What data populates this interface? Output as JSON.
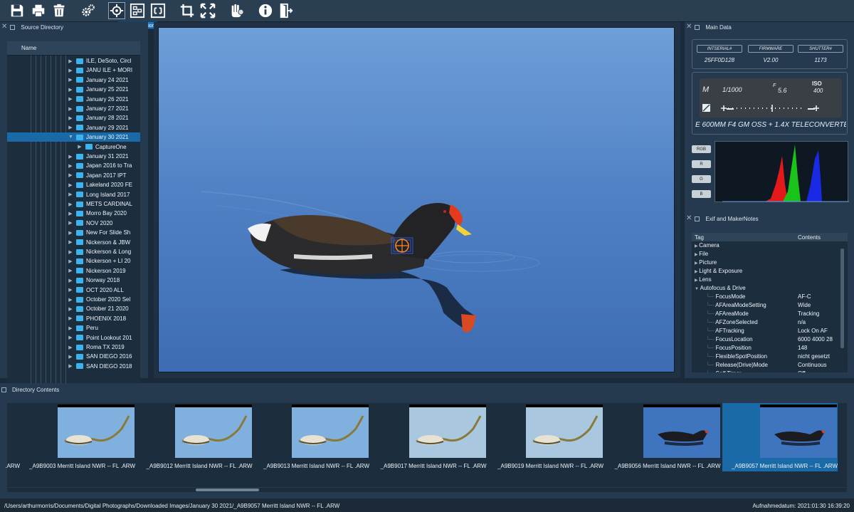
{
  "toolbar": {
    "tooltip": "Focus Location",
    "icons": [
      "save-icon",
      "print-icon",
      "delete-icon",
      "settings-icon",
      "focus-location-icon",
      "af-points-icon",
      "frame-icon",
      "crop-icon",
      "fullscreen-icon",
      "hand-icon",
      "info-icon",
      "exit-icon"
    ]
  },
  "source_directory": {
    "title": "Source Directory",
    "column": "Name",
    "items": [
      {
        "label": "ILE, DeSoto, Circl",
        "level": 0,
        "expanded": false,
        "selected": false
      },
      {
        "label": "JANU ILE + MORI",
        "level": 0,
        "expanded": false,
        "selected": false
      },
      {
        "label": "January 24 2021",
        "level": 0,
        "expanded": false,
        "selected": false
      },
      {
        "label": "January 25 2021",
        "level": 0,
        "expanded": false,
        "selected": false
      },
      {
        "label": "January 26 2021",
        "level": 0,
        "expanded": false,
        "selected": false
      },
      {
        "label": "January 27 2021",
        "level": 0,
        "expanded": false,
        "selected": false
      },
      {
        "label": "January 28 2021",
        "level": 0,
        "expanded": false,
        "selected": false
      },
      {
        "label": "January 29 2021",
        "level": 0,
        "expanded": false,
        "selected": false
      },
      {
        "label": "January 30 2021",
        "level": 0,
        "expanded": true,
        "selected": true
      },
      {
        "label": "CaptureOne",
        "level": 1,
        "expanded": false,
        "selected": false
      },
      {
        "label": "January 31 2021",
        "level": 0,
        "expanded": false,
        "selected": false
      },
      {
        "label": "Japan 2016 to Tra",
        "level": 0,
        "expanded": false,
        "selected": false
      },
      {
        "label": "Japan 2017 IPT",
        "level": 0,
        "expanded": false,
        "selected": false
      },
      {
        "label": "Lakeland 2020 FE",
        "level": 0,
        "expanded": false,
        "selected": false
      },
      {
        "label": "Long Island 2017",
        "level": 0,
        "expanded": false,
        "selected": false
      },
      {
        "label": "METS CARDINAL",
        "level": 0,
        "expanded": false,
        "selected": false
      },
      {
        "label": "Morro Bay 2020",
        "level": 0,
        "expanded": false,
        "selected": false
      },
      {
        "label": "NOV 2020",
        "level": 0,
        "expanded": false,
        "selected": false
      },
      {
        "label": "New For Slide Sh",
        "level": 0,
        "expanded": false,
        "selected": false
      },
      {
        "label": "Nickerson & JBW",
        "level": 0,
        "expanded": false,
        "selected": false
      },
      {
        "label": "Nickerson & Long",
        "level": 0,
        "expanded": false,
        "selected": false
      },
      {
        "label": "Nickerson + LI 20",
        "level": 0,
        "expanded": false,
        "selected": false
      },
      {
        "label": "Nickerson 2019",
        "level": 0,
        "expanded": false,
        "selected": false
      },
      {
        "label": "Norway 2018",
        "level": 0,
        "expanded": false,
        "selected": false
      },
      {
        "label": "OCT 2020 ALL",
        "level": 0,
        "expanded": false,
        "selected": false
      },
      {
        "label": "October 2020 Sel",
        "level": 0,
        "expanded": false,
        "selected": false
      },
      {
        "label": "October 21 2020",
        "level": 0,
        "expanded": false,
        "selected": false
      },
      {
        "label": "PHOENIX 2018",
        "level": 0,
        "expanded": false,
        "selected": false
      },
      {
        "label": "Peru",
        "level": 0,
        "expanded": false,
        "selected": false
      },
      {
        "label": "Point Lookout 201",
        "level": 0,
        "expanded": false,
        "selected": false
      },
      {
        "label": "Roma TX 2019",
        "level": 0,
        "expanded": false,
        "selected": false
      },
      {
        "label": "SAN DIEGO 2016",
        "level": 0,
        "expanded": false,
        "selected": false
      },
      {
        "label": "SAN DIEGO 2018",
        "level": 0,
        "expanded": false,
        "selected": false
      }
    ]
  },
  "main_data": {
    "title": "Main Data",
    "intserial_label": "INTSERIAL#",
    "intserial_value": "25FF0D128",
    "firmware_label": "FIRMWARE",
    "firmware_value": "V2.00",
    "shutter_label": "SHUTTER#",
    "shutter_value": "1173",
    "mode": "M",
    "shutter_speed": "1/1000",
    "f_label": "F",
    "aperture": "5.6",
    "iso_label": "ISO",
    "iso_value": "400",
    "lens": "E 600MM F4 GM OSS + 1.4X TELECONVERTE",
    "hist_buttons": [
      "RGB",
      "R",
      "G",
      "B"
    ]
  },
  "exif": {
    "title": "Exif and MakerNotes",
    "col_tag": "Tag",
    "col_contents": "Contents",
    "rows": [
      {
        "tag": "Camera",
        "value": "",
        "level": 0,
        "expanded": false
      },
      {
        "tag": "File",
        "value": "",
        "level": 0,
        "expanded": false
      },
      {
        "tag": "Picture",
        "value": "",
        "level": 0,
        "expanded": false
      },
      {
        "tag": "Light & Exposure",
        "value": "",
        "level": 0,
        "expanded": false
      },
      {
        "tag": "Lens",
        "value": "",
        "level": 0,
        "expanded": false
      },
      {
        "tag": "Autofocus & Drive",
        "value": "",
        "level": 0,
        "expanded": true
      },
      {
        "tag": "FocusMode",
        "value": "AF-C",
        "level": 1
      },
      {
        "tag": "AFAreaModeSetting",
        "value": "Wide",
        "level": 1
      },
      {
        "tag": "AFAreaMode",
        "value": "Tracking",
        "level": 1
      },
      {
        "tag": "AFZoneSelected",
        "value": "n/a",
        "level": 1
      },
      {
        "tag": "AFTracking",
        "value": "Lock On AF",
        "level": 1
      },
      {
        "tag": "FocusLocation",
        "value": "6000 4000 28",
        "level": 1
      },
      {
        "tag": "FocusPosition",
        "value": "148",
        "level": 1
      },
      {
        "tag": "FlexibleSpotPosition",
        "value": "nicht gesetzt",
        "level": 1
      },
      {
        "tag": "Release(Drive)Mode",
        "value": "Continuous",
        "level": 1
      },
      {
        "tag": "Self Timer",
        "value": "Off",
        "level": 1
      }
    ]
  },
  "directory_contents": {
    "title": "Directory Contents",
    "thumbs": [
      {
        "caption": ".ARW",
        "kind": "egret-stick",
        "selected": false
      },
      {
        "caption": "_A9B9003  Merritt Island NWR -- FL .ARW",
        "kind": "egret-stick",
        "selected": false
      },
      {
        "caption": "_A9B9012  Merritt Island NWR -- FL .ARW",
        "kind": "egret-stick",
        "selected": false
      },
      {
        "caption": "_A9B9013  Merritt Island NWR -- FL .ARW",
        "kind": "egret-stick",
        "selected": false
      },
      {
        "caption": "_A9B9017  Merritt Island NWR -- FL .ARW",
        "kind": "egret-pale",
        "selected": false
      },
      {
        "caption": "_A9B9019  Merritt Island NWR -- FL .ARW",
        "kind": "egret-pale",
        "selected": false
      },
      {
        "caption": "_A9B9056  Merritt Island NWR -- FL .ARW",
        "kind": "gallinule",
        "selected": false
      },
      {
        "caption": "_A9B9057  Merritt Island NWR -- FL .ARW",
        "kind": "gallinule",
        "selected": true
      }
    ]
  },
  "status": {
    "path": "/Users/arthurmorris/Documents/Digital Photographs/Downloaded Images/January 30 2021/_A9B9057  Merritt Island NWR -- FL .ARW",
    "date": "Aufnahmedatum: 2021:01:30 16:39:20"
  }
}
